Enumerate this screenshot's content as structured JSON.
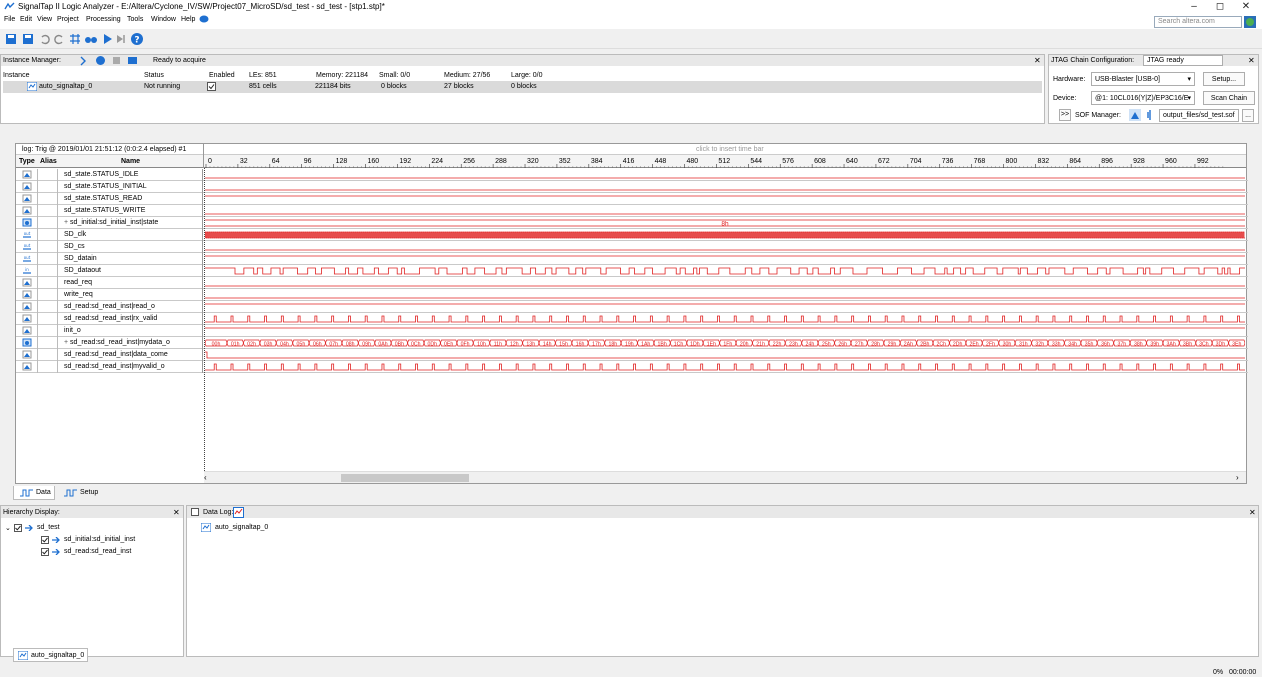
{
  "window": {
    "title": "SignalTap II Logic Analyzer - E:/Altera/Cyclone_IV/SW/Project07_MicroSD/sd_test - sd_test - [stp1.stp]*",
    "minimize": "–",
    "restore": "◻",
    "close": "✕"
  },
  "menu": [
    "File",
    "Edit",
    "View",
    "Project",
    "Processing",
    "Tools",
    "Window",
    "Help"
  ],
  "search": {
    "placeholder": "Search altera.com"
  },
  "instance_manager": {
    "label": "Instance Manager:",
    "status": "Ready to acquire",
    "headers": [
      "Instance",
      "Status",
      "Enabled",
      "LEs: 851",
      "Memory: 221184",
      "Small: 0/0",
      "Medium: 27/56",
      "Large: 0/0"
    ],
    "row": {
      "instance": "auto_signaltap_0",
      "status": "Not running",
      "enabled": true,
      "les": "851 cells",
      "memory": "221184 bits",
      "small": "0 blocks",
      "medium": "27 blocks",
      "large": "0 blocks"
    }
  },
  "jtag": {
    "label": "JTAG Chain Configuration:",
    "status": "JTAG ready",
    "hardware_label": "Hardware:",
    "hardware_value": "USB-Blaster [USB-0]",
    "setup_btn": "Setup...",
    "device_label": "Device:",
    "device_value": "@1: 10CL016(Y|Z)/EP3C16/E",
    "scan_btn": "Scan Chain",
    "sof_btn": ">>",
    "sof_label": "SOF Manager:",
    "sof_file": "output_files/sd_test.sof",
    "browse_btn": "..."
  },
  "log": {
    "label": "log: Trig @ 2019/01/01 21:51:12 (0:0:2.4 elapsed) #1",
    "insert_hint": "click to insert time bar",
    "col_type": "Type",
    "col_alias": "Alias",
    "col_name": "Name",
    "ticks": [
      "0",
      "32",
      "64",
      "96",
      "128",
      "160",
      "192",
      "224",
      "256",
      "288",
      "320",
      "352",
      "384",
      "416",
      "448",
      "480",
      "512",
      "544",
      "576",
      "608",
      "640",
      "672",
      "704",
      "736",
      "768",
      "800",
      "832",
      "864",
      "896",
      "928",
      "960",
      "992"
    ]
  },
  "signals": [
    {
      "name": "sd_state.STATUS_IDLE",
      "type": "c",
      "wave": "low"
    },
    {
      "name": "sd_state.STATUS_INITIAL",
      "type": "c",
      "wave": "low"
    },
    {
      "name": "sd_state.STATUS_READ",
      "type": "c",
      "wave": "high"
    },
    {
      "name": "sd_state.STATUS_WRITE",
      "type": "c",
      "wave": "low"
    },
    {
      "name": "sd_initial:sd_initial_inst|state",
      "type": "bus",
      "wave": "bus-const",
      "value": "8h",
      "expand": "+"
    },
    {
      "name": "SD_clk",
      "type": "out",
      "wave": "clock"
    },
    {
      "name": "SD_cs",
      "type": "out",
      "wave": "low"
    },
    {
      "name": "SD_datain",
      "type": "out",
      "wave": "high"
    },
    {
      "name": "SD_dataout",
      "type": "in",
      "wave": "data"
    },
    {
      "name": "read_req",
      "type": "c",
      "wave": "low"
    },
    {
      "name": "write_req",
      "type": "c",
      "wave": "low"
    },
    {
      "name": "sd_read:sd_read_inst|read_o",
      "type": "c",
      "wave": "high"
    },
    {
      "name": "sd_read:sd_read_inst|rx_valid",
      "type": "c",
      "wave": "pulse"
    },
    {
      "name": "init_o",
      "type": "c",
      "wave": "high"
    },
    {
      "name": "sd_read:sd_read_inst|mydata_o",
      "type": "bus",
      "wave": "bus-count",
      "expand": "+",
      "values": [
        "00h",
        "01h",
        "02h",
        "03h",
        "04h",
        "05h",
        "06h",
        "07h",
        "08h",
        "09h",
        "0Ah",
        "0Bh",
        "0Ch",
        "0Dh",
        "0Eh",
        "0Fh",
        "10h",
        "11h",
        "12h",
        "13h",
        "14h",
        "15h",
        "16h",
        "17h",
        "18h",
        "19h",
        "1Ah",
        "1Bh",
        "1Ch",
        "1Dh",
        "1Eh",
        "1Fh",
        "20h",
        "21h",
        "22h",
        "23h",
        "24h",
        "25h",
        "26h",
        "27h",
        "28h",
        "29h",
        "2Ah",
        "2Bh",
        "2Ch",
        "2Dh",
        "2Eh",
        "2Fh",
        "30h",
        "31h",
        "32h",
        "33h",
        "34h",
        "35h",
        "36h",
        "37h",
        "38h",
        "39h",
        "3Ah",
        "3Bh",
        "3Ch",
        "3Dh",
        "3Eh"
      ]
    },
    {
      "name": "sd_read:sd_read_inst|data_come",
      "type": "c",
      "wave": "short"
    },
    {
      "name": "sd_read:sd_read_inst|myvalid_o",
      "type": "c",
      "wave": "pulse"
    }
  ],
  "tabs": {
    "data": "Data",
    "setup": "Setup"
  },
  "hierarchy": {
    "label": "Hierarchy Display:",
    "items": [
      {
        "label": "sd_test",
        "level": 0
      },
      {
        "label": "sd_initial:sd_initial_inst",
        "level": 1
      },
      {
        "label": "sd_read:sd_read_inst",
        "level": 1
      }
    ]
  },
  "datalog": {
    "label": "Data Log:",
    "item": "auto_signaltap_0"
  },
  "bottom_tab": "auto_signaltap_0",
  "status": {
    "percent": "0%",
    "time": "00:00:00"
  },
  "colors": {
    "wave": "#e02020",
    "accent": "#1e6fd0"
  }
}
